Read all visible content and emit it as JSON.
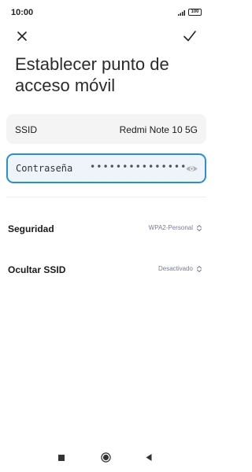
{
  "status_bar": {
    "time": "10:00",
    "battery": "100",
    "icons": [
      "signal-icon",
      "battery-icon"
    ]
  },
  "toolbar": {
    "close_icon": "close-icon",
    "confirm_icon": "check-icon"
  },
  "page": {
    "title": "Establecer punto de acceso móvil"
  },
  "ssid": {
    "label": "SSID",
    "value": "Redmi Note 10 5G"
  },
  "password": {
    "label": "Contraseña",
    "value": "•••••••••••••••",
    "toggle_icon": "eye-icon"
  },
  "settings": [
    {
      "label": "Seguridad",
      "value": "WPA2-Personal"
    },
    {
      "label": "Ocultar SSID",
      "value": "Desactivado"
    }
  ],
  "nav": {
    "icons": [
      "recents-icon",
      "home-icon",
      "back-icon"
    ]
  },
  "colors": {
    "accent": "#2a8fd6",
    "card_bg": "#f4f4f4",
    "field_bg": "#eef4f9",
    "secondary_text": "#7a7a9a"
  }
}
